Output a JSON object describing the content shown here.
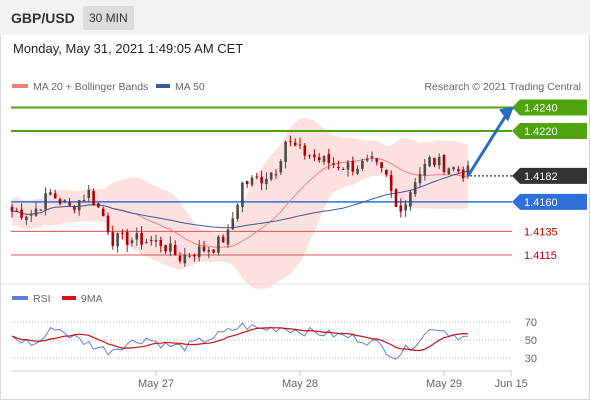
{
  "header": {
    "pair": "GBP/USD",
    "timeframe": "30 MIN",
    "timestamp": "Monday, May 31, 2021 1:49:05 AM CET"
  },
  "legend": {
    "bollinger": "MA 20 + Bollinger Bands",
    "ma50": "MA 50",
    "credit": "Research © 2021 Trading Central"
  },
  "rsi_legend": {
    "rsi": "RSI",
    "ma": "9MA"
  },
  "colors": {
    "up": "#4a4a4a",
    "down": "#b00000",
    "band": "#fde0e0",
    "ma20": "#f08080",
    "ma50": "#3b5a9a",
    "target": "#4ea30f",
    "pivot": "#2f6fdc",
    "support": "#e05050",
    "current": "#333333",
    "arrow": "#2a6bc4"
  },
  "chart_data": [
    {
      "type": "candlestick",
      "title": "",
      "price_range": [
        1.4098,
        1.4248
      ],
      "levels": [
        {
          "label": "1.4240",
          "value": 1.424,
          "kind": "target"
        },
        {
          "label": "1.4220",
          "value": 1.422,
          "kind": "target"
        },
        {
          "label": "1.4182",
          "value": 1.4182,
          "kind": "current"
        },
        {
          "label": "1.4160",
          "value": 1.416,
          "kind": "pivot"
        },
        {
          "label": "1.4135",
          "value": 1.4135,
          "kind": "support"
        },
        {
          "label": "1.4115",
          "value": 1.4115,
          "kind": "support"
        }
      ],
      "x_labels": [
        {
          "label": "May 27",
          "index": 30
        },
        {
          "label": "May 28",
          "index": 60
        },
        {
          "label": "May 29",
          "index": 90
        },
        {
          "label": "Jun 15",
          "index": 104
        }
      ],
      "close_anchors": [
        [
          0,
          1.4152
        ],
        [
          4,
          1.415
        ],
        [
          8,
          1.4167
        ],
        [
          12,
          1.4155
        ],
        [
          16,
          1.4168
        ],
        [
          19,
          1.4148
        ],
        [
          21,
          1.4128
        ],
        [
          26,
          1.4128
        ],
        [
          31,
          1.4125
        ],
        [
          35,
          1.4113
        ],
        [
          38,
          1.4118
        ],
        [
          42,
          1.4122
        ],
        [
          45,
          1.4132
        ],
        [
          48,
          1.4175
        ],
        [
          52,
          1.418
        ],
        [
          55,
          1.4188
        ],
        [
          57,
          1.4212
        ],
        [
          60,
          1.4203
        ],
        [
          64,
          1.4196
        ],
        [
          67,
          1.4192
        ],
        [
          71,
          1.419
        ],
        [
          75,
          1.4193
        ],
        [
          78,
          1.418
        ],
        [
          80,
          1.4155
        ],
        [
          82,
          1.416
        ],
        [
          84,
          1.418
        ],
        [
          87,
          1.4195
        ],
        [
          91,
          1.419
        ],
        [
          94,
          1.4185
        ],
        [
          95,
          1.4185
        ]
      ],
      "projection": {
        "from": 1.4182,
        "to": 1.424
      }
    },
    {
      "type": "line",
      "title": "RSI",
      "y_ticks": [
        70,
        50,
        30
      ],
      "y_range": [
        20,
        80
      ],
      "rsi_anchors": [
        [
          0,
          52
        ],
        [
          5,
          45
        ],
        [
          9,
          65
        ],
        [
          12,
          55
        ],
        [
          15,
          48
        ],
        [
          20,
          38
        ],
        [
          24,
          46
        ],
        [
          28,
          52
        ],
        [
          32,
          44
        ],
        [
          36,
          42
        ],
        [
          40,
          50
        ],
        [
          44,
          57
        ],
        [
          48,
          66
        ],
        [
          52,
          62
        ],
        [
          56,
          64
        ],
        [
          60,
          60
        ],
        [
          64,
          58
        ],
        [
          68,
          55
        ],
        [
          72,
          52
        ],
        [
          76,
          46
        ],
        [
          80,
          32
        ],
        [
          84,
          47
        ],
        [
          88,
          65
        ],
        [
          92,
          56
        ],
        [
          95,
          52
        ]
      ],
      "ma_anchors": [
        [
          0,
          51
        ],
        [
          10,
          55
        ],
        [
          20,
          47
        ],
        [
          30,
          45
        ],
        [
          40,
          50
        ],
        [
          50,
          58
        ],
        [
          60,
          63
        ],
        [
          70,
          57
        ],
        [
          78,
          49
        ],
        [
          82,
          38
        ],
        [
          88,
          57
        ],
        [
          95,
          53
        ]
      ]
    }
  ]
}
